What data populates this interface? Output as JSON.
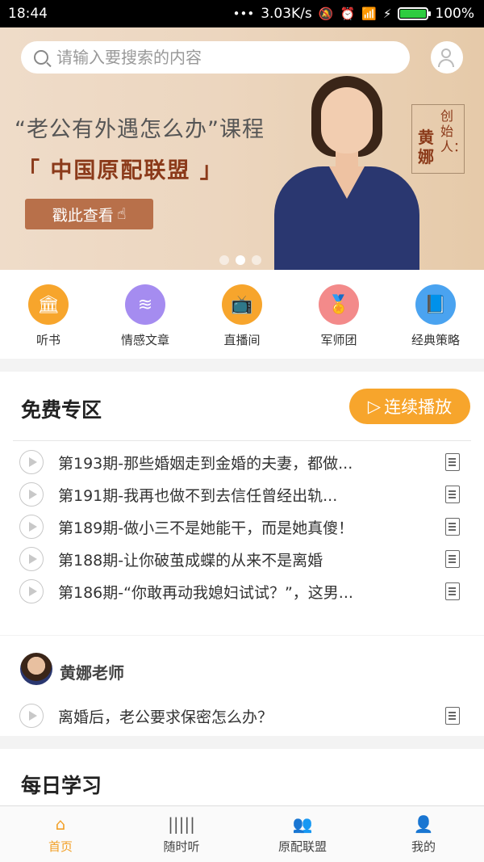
{
  "status_bar": {
    "time": "18:44",
    "dots": "•••",
    "speed": "3.03K/s",
    "battery": "100%"
  },
  "banner": {
    "search_placeholder": "请输入要搜索的内容",
    "headline": "“老公有外遇怎么办”课程",
    "brand": "「 中国原配联盟 」",
    "cta_label": "戳此查看",
    "founder_title": "创始人：",
    "founder_name": "黄娜",
    "slide_count": 3,
    "active_slide": 2
  },
  "categories": [
    {
      "label": "听书",
      "icon": "bank-icon",
      "color": "#f7a52c"
    },
    {
      "label": "情感文章",
      "icon": "layers-icon",
      "color": "#a58cf0"
    },
    {
      "label": "直播间",
      "icon": "tv-icon",
      "color": "#f7a52c"
    },
    {
      "label": "军师团",
      "icon": "award-icon",
      "color": "#f38a8a"
    },
    {
      "label": "经典策略",
      "icon": "book-icon",
      "color": "#4aa3f0"
    }
  ],
  "free_zone": {
    "title": "免费专区",
    "play_all_label": "连续播放",
    "items": [
      "第193期-那些婚姻走到金婚的夫妻，都做...",
      "第191期-我再也做不到去信任曾经出轨...",
      "第189期-做小三不是她能干，而是她真傻！",
      "第188期-让你破茧成蝶的从来不是离婚",
      "第186期-“你敢再动我媳妇试试？”，这男..."
    ]
  },
  "teacher": {
    "name": "黄娜老师",
    "items": [
      "离婚后，老公要求保密怎么办？"
    ]
  },
  "daily": {
    "title": "每日学习"
  },
  "tabs": [
    {
      "label": "首页",
      "icon": "home-icon",
      "active": true
    },
    {
      "label": "随时听",
      "icon": "audio-wave-icon",
      "active": false
    },
    {
      "label": "原配联盟",
      "icon": "group-icon",
      "active": false
    },
    {
      "label": "我的",
      "icon": "person-icon",
      "active": false
    }
  ]
}
